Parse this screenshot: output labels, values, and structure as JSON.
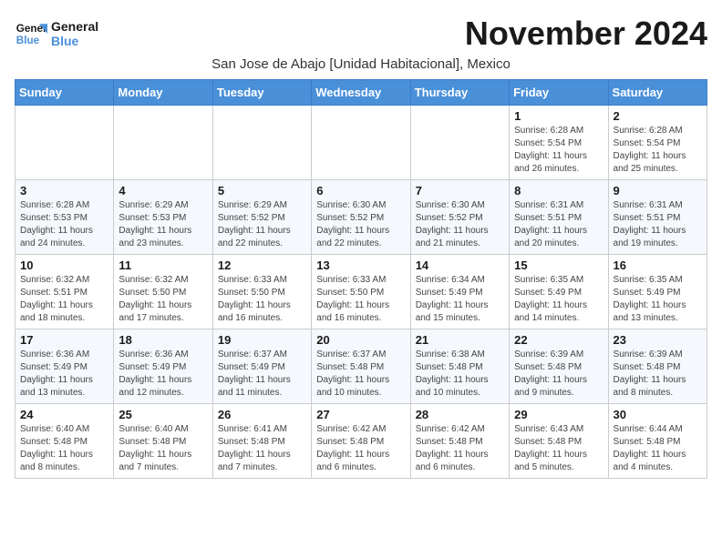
{
  "logo": {
    "line1": "General",
    "line2": "Blue"
  },
  "title": "November 2024",
  "location": "San Jose de Abajo [Unidad Habitacional], Mexico",
  "days_of_week": [
    "Sunday",
    "Monday",
    "Tuesday",
    "Wednesday",
    "Thursday",
    "Friday",
    "Saturday"
  ],
  "weeks": [
    [
      {
        "day": "",
        "info": ""
      },
      {
        "day": "",
        "info": ""
      },
      {
        "day": "",
        "info": ""
      },
      {
        "day": "",
        "info": ""
      },
      {
        "day": "",
        "info": ""
      },
      {
        "day": "1",
        "info": "Sunrise: 6:28 AM\nSunset: 5:54 PM\nDaylight: 11 hours and 26 minutes."
      },
      {
        "day": "2",
        "info": "Sunrise: 6:28 AM\nSunset: 5:54 PM\nDaylight: 11 hours and 25 minutes."
      }
    ],
    [
      {
        "day": "3",
        "info": "Sunrise: 6:28 AM\nSunset: 5:53 PM\nDaylight: 11 hours and 24 minutes."
      },
      {
        "day": "4",
        "info": "Sunrise: 6:29 AM\nSunset: 5:53 PM\nDaylight: 11 hours and 23 minutes."
      },
      {
        "day": "5",
        "info": "Sunrise: 6:29 AM\nSunset: 5:52 PM\nDaylight: 11 hours and 22 minutes."
      },
      {
        "day": "6",
        "info": "Sunrise: 6:30 AM\nSunset: 5:52 PM\nDaylight: 11 hours and 22 minutes."
      },
      {
        "day": "7",
        "info": "Sunrise: 6:30 AM\nSunset: 5:52 PM\nDaylight: 11 hours and 21 minutes."
      },
      {
        "day": "8",
        "info": "Sunrise: 6:31 AM\nSunset: 5:51 PM\nDaylight: 11 hours and 20 minutes."
      },
      {
        "day": "9",
        "info": "Sunrise: 6:31 AM\nSunset: 5:51 PM\nDaylight: 11 hours and 19 minutes."
      }
    ],
    [
      {
        "day": "10",
        "info": "Sunrise: 6:32 AM\nSunset: 5:51 PM\nDaylight: 11 hours and 18 minutes."
      },
      {
        "day": "11",
        "info": "Sunrise: 6:32 AM\nSunset: 5:50 PM\nDaylight: 11 hours and 17 minutes."
      },
      {
        "day": "12",
        "info": "Sunrise: 6:33 AM\nSunset: 5:50 PM\nDaylight: 11 hours and 16 minutes."
      },
      {
        "day": "13",
        "info": "Sunrise: 6:33 AM\nSunset: 5:50 PM\nDaylight: 11 hours and 16 minutes."
      },
      {
        "day": "14",
        "info": "Sunrise: 6:34 AM\nSunset: 5:49 PM\nDaylight: 11 hours and 15 minutes."
      },
      {
        "day": "15",
        "info": "Sunrise: 6:35 AM\nSunset: 5:49 PM\nDaylight: 11 hours and 14 minutes."
      },
      {
        "day": "16",
        "info": "Sunrise: 6:35 AM\nSunset: 5:49 PM\nDaylight: 11 hours and 13 minutes."
      }
    ],
    [
      {
        "day": "17",
        "info": "Sunrise: 6:36 AM\nSunset: 5:49 PM\nDaylight: 11 hours and 13 minutes."
      },
      {
        "day": "18",
        "info": "Sunrise: 6:36 AM\nSunset: 5:49 PM\nDaylight: 11 hours and 12 minutes."
      },
      {
        "day": "19",
        "info": "Sunrise: 6:37 AM\nSunset: 5:49 PM\nDaylight: 11 hours and 11 minutes."
      },
      {
        "day": "20",
        "info": "Sunrise: 6:37 AM\nSunset: 5:48 PM\nDaylight: 11 hours and 10 minutes."
      },
      {
        "day": "21",
        "info": "Sunrise: 6:38 AM\nSunset: 5:48 PM\nDaylight: 11 hours and 10 minutes."
      },
      {
        "day": "22",
        "info": "Sunrise: 6:39 AM\nSunset: 5:48 PM\nDaylight: 11 hours and 9 minutes."
      },
      {
        "day": "23",
        "info": "Sunrise: 6:39 AM\nSunset: 5:48 PM\nDaylight: 11 hours and 8 minutes."
      }
    ],
    [
      {
        "day": "24",
        "info": "Sunrise: 6:40 AM\nSunset: 5:48 PM\nDaylight: 11 hours and 8 minutes."
      },
      {
        "day": "25",
        "info": "Sunrise: 6:40 AM\nSunset: 5:48 PM\nDaylight: 11 hours and 7 minutes."
      },
      {
        "day": "26",
        "info": "Sunrise: 6:41 AM\nSunset: 5:48 PM\nDaylight: 11 hours and 7 minutes."
      },
      {
        "day": "27",
        "info": "Sunrise: 6:42 AM\nSunset: 5:48 PM\nDaylight: 11 hours and 6 minutes."
      },
      {
        "day": "28",
        "info": "Sunrise: 6:42 AM\nSunset: 5:48 PM\nDaylight: 11 hours and 6 minutes."
      },
      {
        "day": "29",
        "info": "Sunrise: 6:43 AM\nSunset: 5:48 PM\nDaylight: 11 hours and 5 minutes."
      },
      {
        "day": "30",
        "info": "Sunrise: 6:44 AM\nSunset: 5:48 PM\nDaylight: 11 hours and 4 minutes."
      }
    ]
  ]
}
